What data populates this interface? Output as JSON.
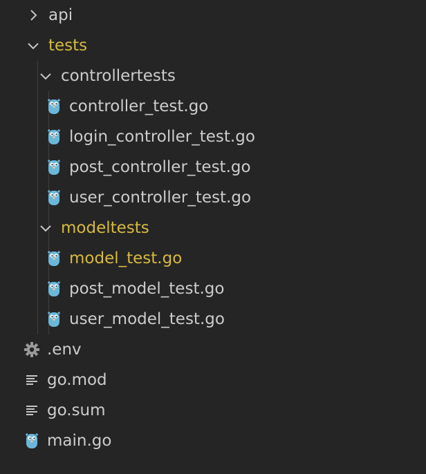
{
  "explorer": {
    "items": [
      {
        "label": "api",
        "kind": "folder",
        "expanded": false,
        "level": 0,
        "icon": "chevron-right-icon",
        "modified": false
      },
      {
        "label": "tests",
        "kind": "folder",
        "expanded": true,
        "level": 0,
        "icon": "chevron-down-icon",
        "modified": true
      },
      {
        "label": "controllertests",
        "kind": "folder",
        "expanded": true,
        "level": 1,
        "icon": "chevron-down-icon",
        "modified": false
      },
      {
        "label": "controller_test.go",
        "kind": "file",
        "level": 2,
        "icon": "go-gopher-icon",
        "modified": false
      },
      {
        "label": "login_controller_test.go",
        "kind": "file",
        "level": 2,
        "icon": "go-gopher-icon",
        "modified": false
      },
      {
        "label": "post_controller_test.go",
        "kind": "file",
        "level": 2,
        "icon": "go-gopher-icon",
        "modified": false
      },
      {
        "label": "user_controller_test.go",
        "kind": "file",
        "level": 2,
        "icon": "go-gopher-icon",
        "modified": false
      },
      {
        "label": "modeltests",
        "kind": "folder",
        "expanded": true,
        "level": 1,
        "icon": "chevron-down-icon",
        "modified": true
      },
      {
        "label": "model_test.go",
        "kind": "file",
        "level": 2,
        "icon": "go-gopher-icon",
        "modified": true
      },
      {
        "label": "post_model_test.go",
        "kind": "file",
        "level": 2,
        "icon": "go-gopher-icon",
        "modified": false
      },
      {
        "label": "user_model_test.go",
        "kind": "file",
        "level": 2,
        "icon": "go-gopher-icon",
        "modified": false
      },
      {
        "label": ".env",
        "kind": "file",
        "level": 0,
        "icon": "gear-icon",
        "modified": false
      },
      {
        "label": "go.mod",
        "kind": "file",
        "level": 0,
        "icon": "text-lines-icon",
        "modified": false
      },
      {
        "label": "go.sum",
        "kind": "file",
        "level": 0,
        "icon": "text-lines-icon",
        "modified": false
      },
      {
        "label": "main.go",
        "kind": "file",
        "level": 0,
        "icon": "go-gopher-icon",
        "modified": false
      }
    ]
  },
  "colors": {
    "background": "#252526",
    "text": "#cccccc",
    "modified": "#d7ba3e",
    "go_icon": "#6ab7d9",
    "gear_icon": "#9a9a9a"
  }
}
